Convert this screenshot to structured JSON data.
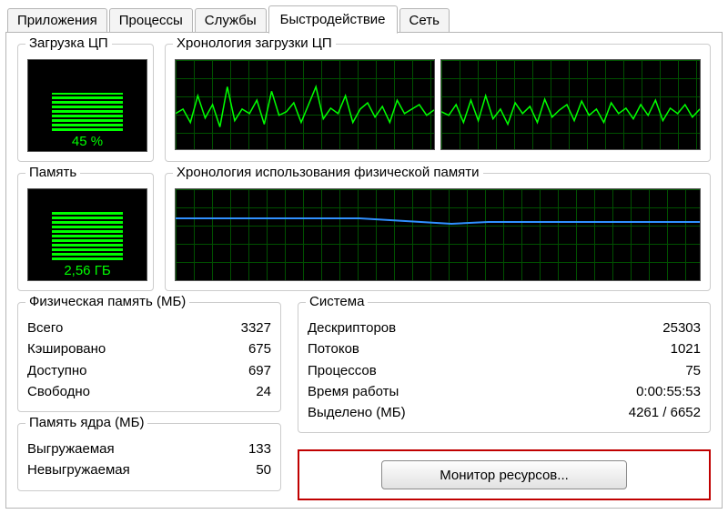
{
  "tabs": {
    "apps": "Приложения",
    "procs": "Процессы",
    "services": "Службы",
    "perf": "Быстродействие",
    "net": "Сеть"
  },
  "groups": {
    "cpu_load": "Загрузка ЦП",
    "cpu_hist": "Хронология загрузки ЦП",
    "mem": "Память",
    "mem_hist": "Хронология использования физической памяти",
    "phys_mem": "Физическая память (МБ)",
    "kernel_mem": "Память ядра (МБ)",
    "system": "Система"
  },
  "gauges": {
    "cpu_pct": "45 %",
    "mem_gb": "2,56 ГБ"
  },
  "phys_mem": {
    "total_k": "Всего",
    "total_v": "3327",
    "cached_k": "Кэшировано",
    "cached_v": "675",
    "avail_k": "Доступно",
    "avail_v": "697",
    "free_k": "Свободно",
    "free_v": "24"
  },
  "kernel_mem": {
    "paged_k": "Выгружаемая",
    "paged_v": "133",
    "nonpaged_k": "Невыгружаемая",
    "nonpaged_v": "50"
  },
  "system": {
    "handles_k": "Дескрипторов",
    "handles_v": "25303",
    "threads_k": "Потоков",
    "threads_v": "1021",
    "procs_k": "Процессов",
    "procs_v": "75",
    "uptime_k": "Время работы",
    "uptime_v": "0:00:55:53",
    "commit_k": "Выделено (МБ)",
    "commit_v": "4261 / 6652"
  },
  "resmon_button": "Монитор ресурсов..."
}
